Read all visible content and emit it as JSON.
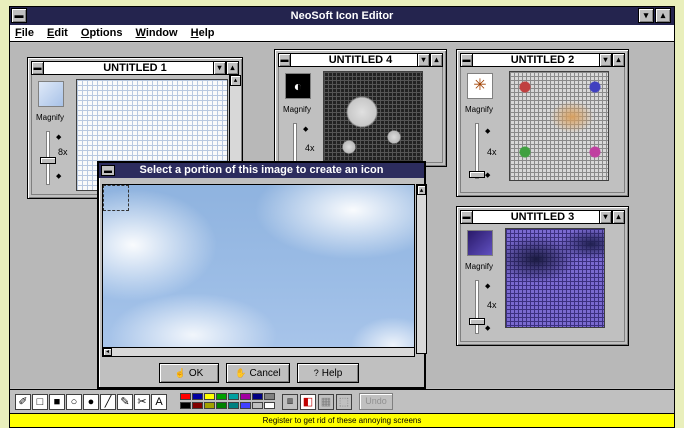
{
  "app": {
    "title": "NeoSoft Icon Editor"
  },
  "menu": [
    "File",
    "Edit",
    "Options",
    "Window",
    "Help"
  ],
  "windows": [
    {
      "title": "UNTITLED 1",
      "magnify_label": "Magnify",
      "magnify_value": "8x"
    },
    {
      "title": "UNTITLED 4",
      "magnify_label": "Magnify",
      "magnify_value": "4x"
    },
    {
      "title": "UNTITLED 2",
      "magnify_label": "Magnify",
      "magnify_value": "4x"
    },
    {
      "title": "UNTITLED 3",
      "magnify_label": "Magnify",
      "magnify_value": "4x"
    }
  ],
  "dialog": {
    "title": "Select a portion of this image to create an icon",
    "ok_label": "OK",
    "cancel_label": "Cancel",
    "help_label": "Help"
  },
  "toolbar": {
    "tools": [
      "brush-icon",
      "rect-outline-icon",
      "rect-filled-icon",
      "ellipse-outline-icon",
      "ellipse-filled-icon",
      "line-icon",
      "fill-icon",
      "scissors-icon",
      "text-icon"
    ],
    "tools_glyphs": [
      "✐",
      "□",
      "■",
      "○",
      "●",
      "╱",
      "✎",
      "✂",
      "A"
    ],
    "palette": [
      "#ff0000",
      "#0000a0",
      "#ffff00",
      "#00a000",
      "#00a0a0",
      "#a000a0",
      "#000080",
      "#808080",
      "#000000",
      "#800000",
      "#a0a000",
      "#008000",
      "#008080",
      "#4040ff",
      "#c0c0c0",
      "#ffffff"
    ],
    "undo_label": "Undo"
  },
  "status": {
    "text": "Register to get rid of these annoying screens"
  }
}
